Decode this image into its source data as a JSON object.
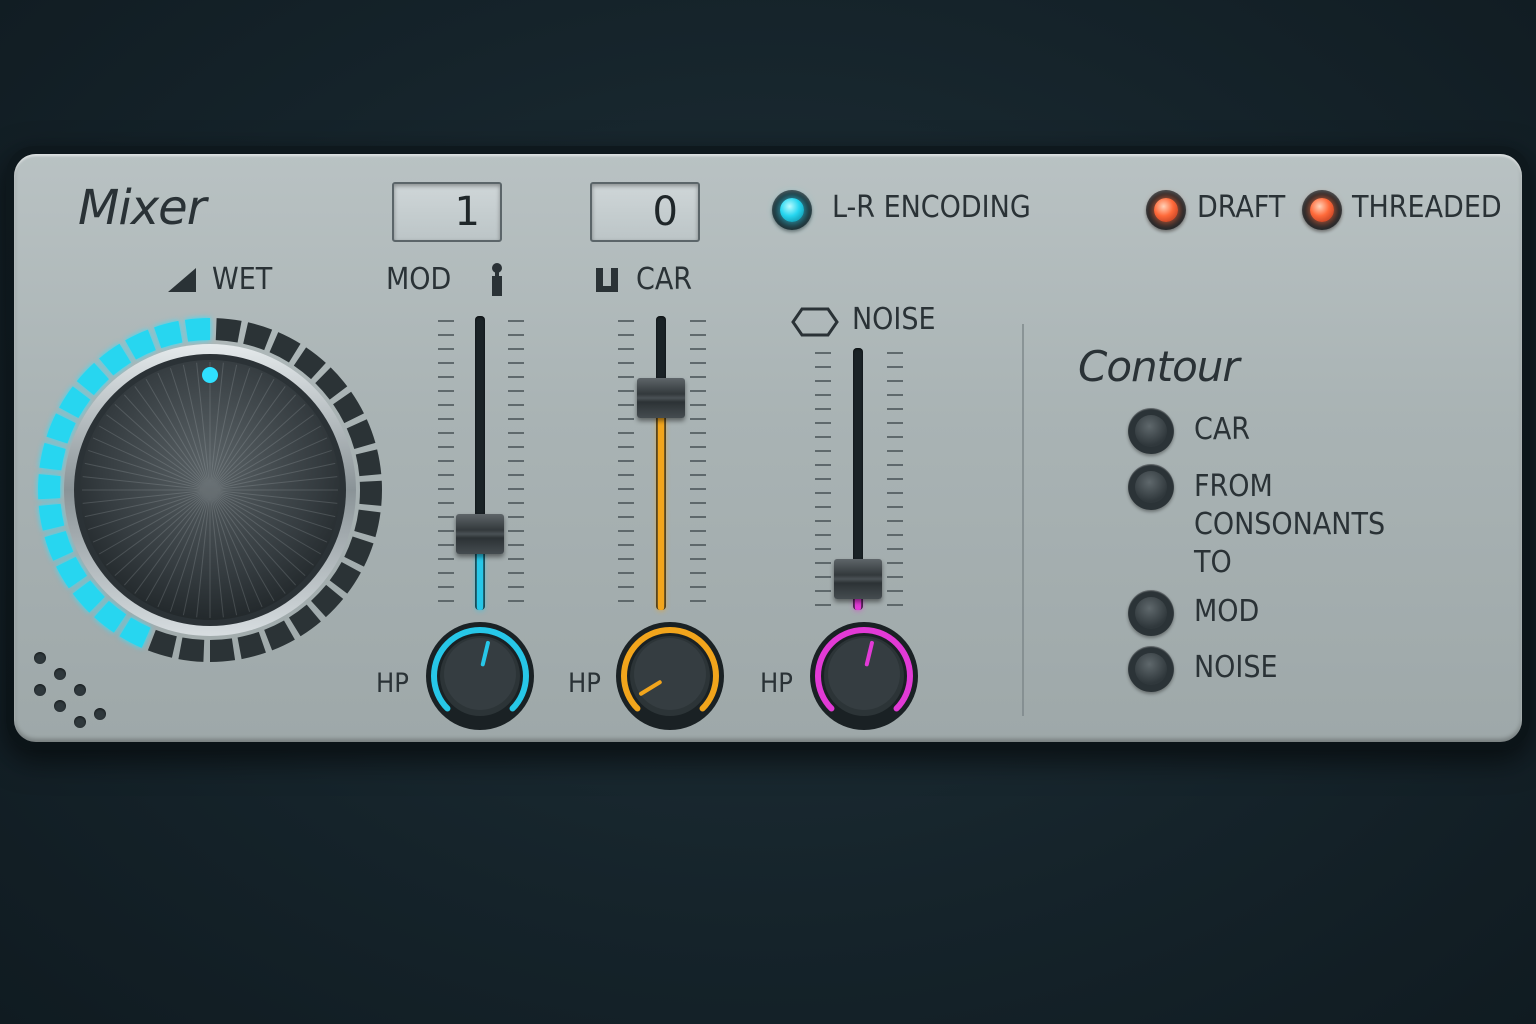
{
  "mixer": {
    "title": "Mixer",
    "wet": {
      "label": "WET",
      "level_percent": 45,
      "accent": "#27d6f0"
    },
    "channels": [
      {
        "id": "mod",
        "label": "MOD",
        "display": "1",
        "fader_level": 0.26,
        "color": "#27c7e8",
        "hp_label": "HP",
        "hp_level": 0.55
      },
      {
        "id": "car",
        "label": "CAR",
        "display": "0",
        "fader_level": 0.72,
        "color": "#f2a51c",
        "hp_label": "HP",
        "hp_level": 0.05
      },
      {
        "id": "noise",
        "label": "NOISE",
        "fader_level": 0.12,
        "color": "#e23ad6",
        "hp_label": "HP",
        "hp_level": 0.55
      }
    ],
    "indicators": [
      {
        "label": "L-R ENCODING",
        "color": "cyan"
      },
      {
        "label": "DRAFT",
        "color": "red"
      },
      {
        "label": "THREADED",
        "color": "red"
      }
    ],
    "contour": {
      "title": "Contour",
      "options": [
        "CAR",
        "FROM CONSONANTS TO",
        "MOD",
        "NOISE"
      ]
    },
    "icons": [
      "ramp-icon",
      "arrow-up-icon",
      "bracket-icon",
      "hexagon-icon",
      "speaker-grille-icon"
    ]
  }
}
